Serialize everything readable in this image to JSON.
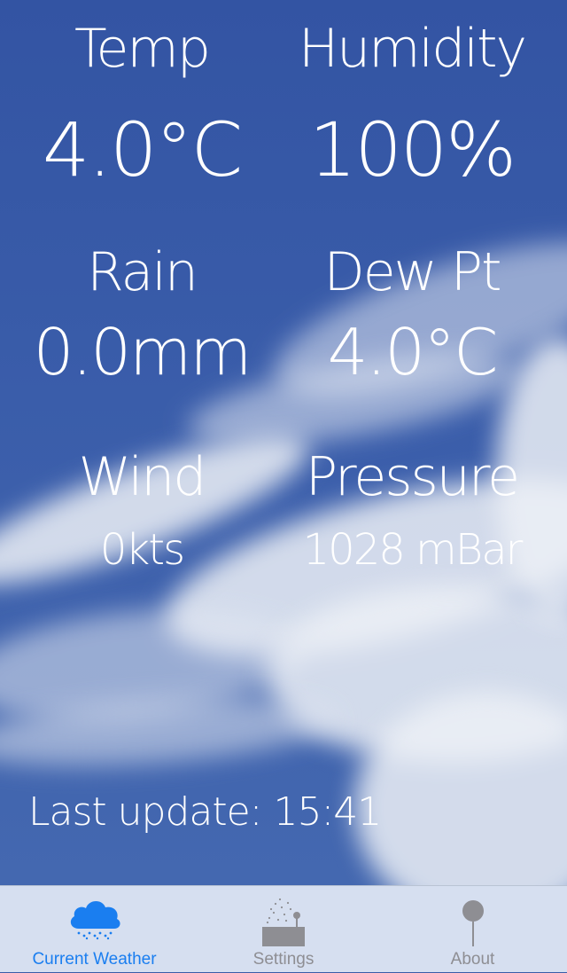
{
  "readings": [
    {
      "label": "Temp",
      "value": "4.0°C"
    },
    {
      "label": "Humidity",
      "value": "100%"
    },
    {
      "label": "Rain",
      "value": "0.0mm"
    },
    {
      "label": "Dew Pt",
      "value": "4.0°C"
    },
    {
      "label": "Wind",
      "value": "0kts"
    },
    {
      "label": "Pressure",
      "value": "1028 mBar"
    }
  ],
  "last_update": "Last update: 15:41",
  "tabs": [
    {
      "label": "Current Weather",
      "icon": "cloud-rain-icon",
      "active": true
    },
    {
      "label": "Settings",
      "icon": "weather-station-icon",
      "active": false
    },
    {
      "label": "About",
      "icon": "pin-icon",
      "active": false
    }
  ],
  "colors": {
    "sky": "#3a5daa",
    "text": "#ffffff",
    "tab_active": "#1a7ef0",
    "tab_inactive": "#8e8e93"
  }
}
